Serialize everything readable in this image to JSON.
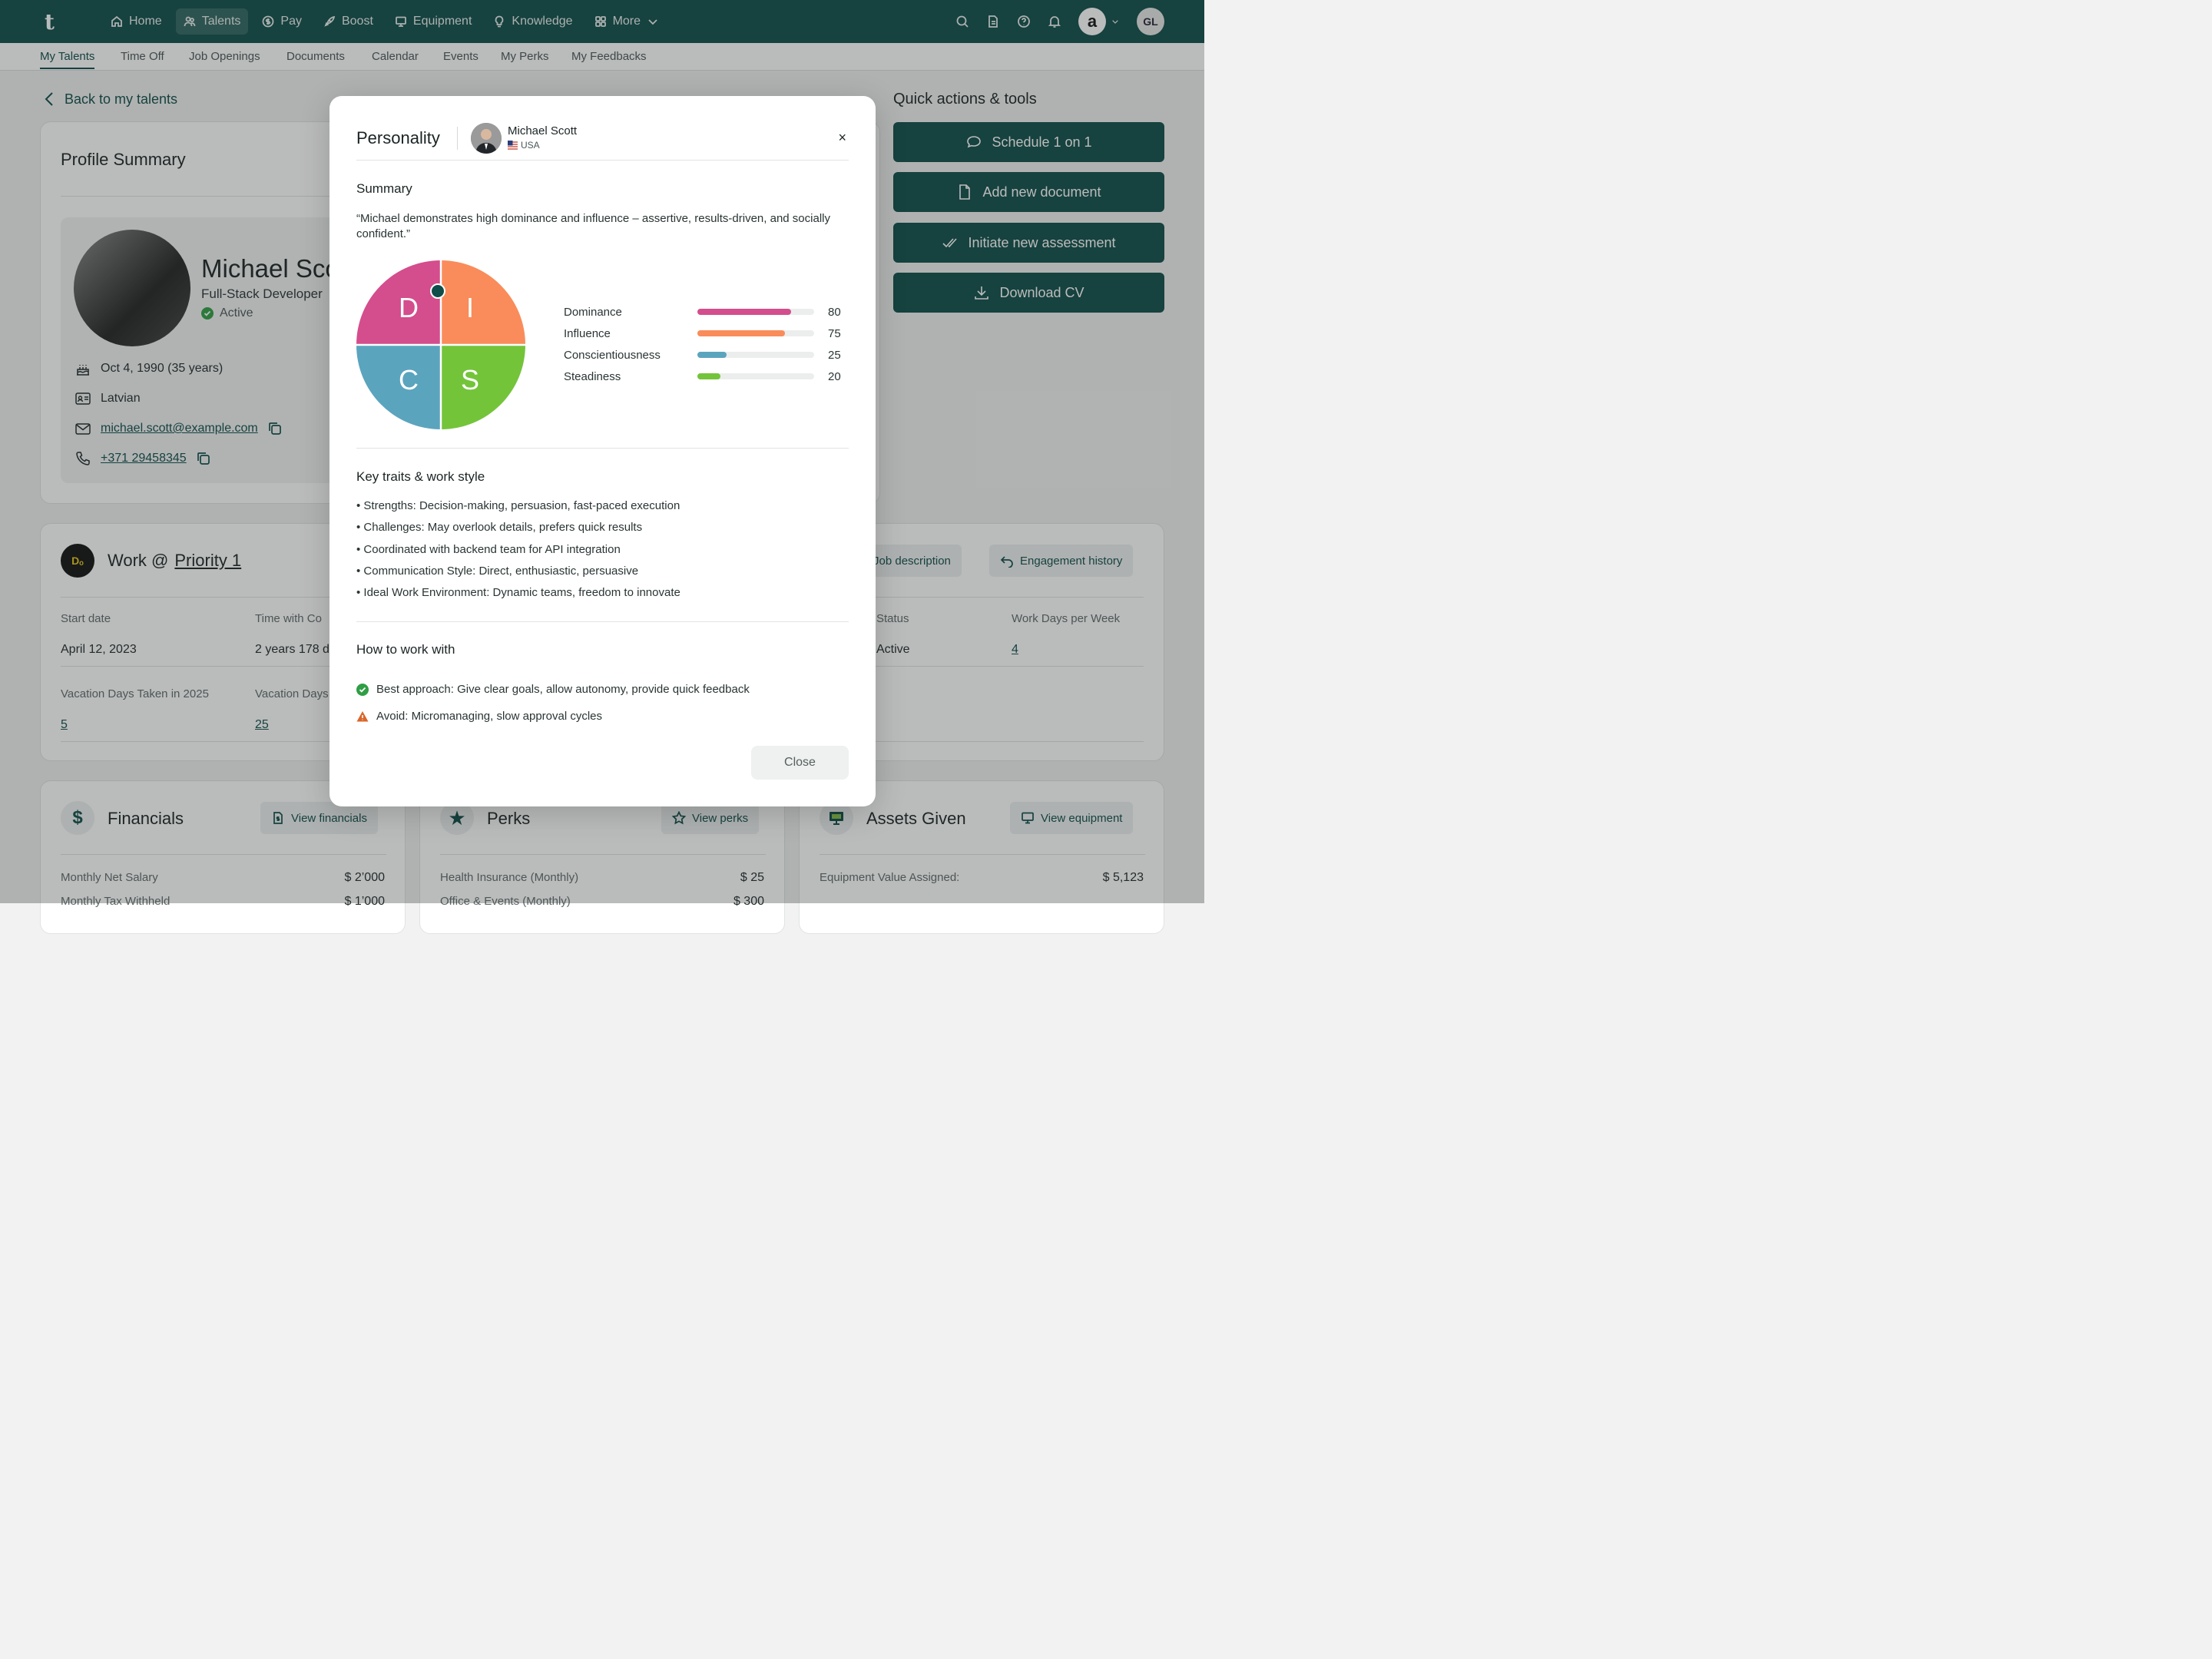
{
  "nav": {
    "logo": "t",
    "items": [
      {
        "label": "Home",
        "icon": "home-icon"
      },
      {
        "label": "Talents",
        "icon": "users-icon"
      },
      {
        "label": "Pay",
        "icon": "dollar-icon"
      },
      {
        "label": "Boost",
        "icon": "rocket-icon"
      },
      {
        "label": "Equipment",
        "icon": "monitor-icon"
      },
      {
        "label": "Knowledge",
        "icon": "bulb-icon"
      },
      {
        "label": "More",
        "icon": "grid-icon"
      }
    ],
    "amazon_logo": "a",
    "user_initials": "GL"
  },
  "subnav": [
    "My Talents",
    "Time Off",
    "Job Openings",
    "Documents",
    "Calendar",
    "Events",
    "My Perks",
    "My Feedbacks"
  ],
  "page": {
    "back_label": "Back to my talents",
    "profile_summary_title": "Profile Summary",
    "name": "Michael Sco",
    "role": "Full-Stack Developer",
    "status": "Active",
    "birth": "Oct 4, 1990 (35 years)",
    "nationality": "Latvian",
    "email": "michael.scott@example.com",
    "phone": "+371 29458345",
    "quick_actions_title": "Quick actions & tools",
    "quick_actions": [
      "Schedule 1 on 1",
      "Add new document",
      "Initiate new assessment",
      "Download CV"
    ],
    "work_title": "Work @",
    "work_company": "Priority 1",
    "job_description": "Job description",
    "engagement_history": "Engagement history",
    "start_date_label": "Start date",
    "start_date": "April 12, 2023",
    "time_with_label": "Time with Co",
    "time_with": "2 years 178 da",
    "status_label": "Status",
    "status_value": "Active",
    "work_days_label": "Work Days per Week",
    "work_days": "4",
    "vac_taken_label": "Vacation Days Taken in 2025",
    "vac_taken": "5",
    "vac_days_label": "Vacation Days",
    "vac_days": "25",
    "financials_title": "Financials",
    "view_financials": "View financials",
    "perks_title": "Perks",
    "view_perks": "View perks",
    "assets_title": "Assets Given",
    "view_equipment": "View equipment",
    "fin_row1_label": "Monthly Net Salary",
    "fin_row1_value": "$ 2’000",
    "fin_row2_label": "Monthly Tax Withheld",
    "fin_row2_value": "$ 1’000",
    "perk_row1_label": "Health Insurance (Monthly)",
    "perk_row1_value": "$ 25",
    "perk_row2_label": "Office & Events (Monthly)",
    "perk_row2_value": "$ 300",
    "asset_row1_label": "Equipment Value Assigned:",
    "asset_row1_value": "$ 5,123"
  },
  "modal": {
    "title": "Personality",
    "person_name": "Michael Scott",
    "person_country": "USA",
    "close_x": "×",
    "summary_title": "Summary",
    "summary_text": "“Michael demonstrates high dominance and influence – assertive, results-driven, and socially confident.”",
    "disc_letters": [
      "D",
      "I",
      "C",
      "S"
    ],
    "disc_colors": {
      "D": "#d44d8c",
      "I": "#f98c5a",
      "C": "#5ba4be",
      "S": "#74c43a",
      "marker": "#0e4d49"
    },
    "scores": [
      {
        "label": "Dominance",
        "value": 80,
        "color": "#d44d8c"
      },
      {
        "label": "Influence",
        "value": 75,
        "color": "#f98c5a"
      },
      {
        "label": "Conscientiousness",
        "value": 25,
        "color": "#5ba4be"
      },
      {
        "label": "Steadiness",
        "value": 20,
        "color": "#74c43a"
      }
    ],
    "traits_title": "Key traits & work style",
    "traits": [
      "• Strengths: Decision-making, persuasion, fast-paced execution",
      "• Challenges: May overlook details, prefers quick results",
      "• Coordinated with backend team for API integration",
      "• Communication Style: Direct, enthusiastic, persuasive",
      "• Ideal Work Environment: Dynamic teams, freedom to innovate"
    ],
    "how_title": "How to work with",
    "best": "Best approach: Give clear goals, allow autonomy, provide quick feedback",
    "avoid": "Avoid: Micromanaging, slow approval cycles",
    "close_button": "Close"
  }
}
